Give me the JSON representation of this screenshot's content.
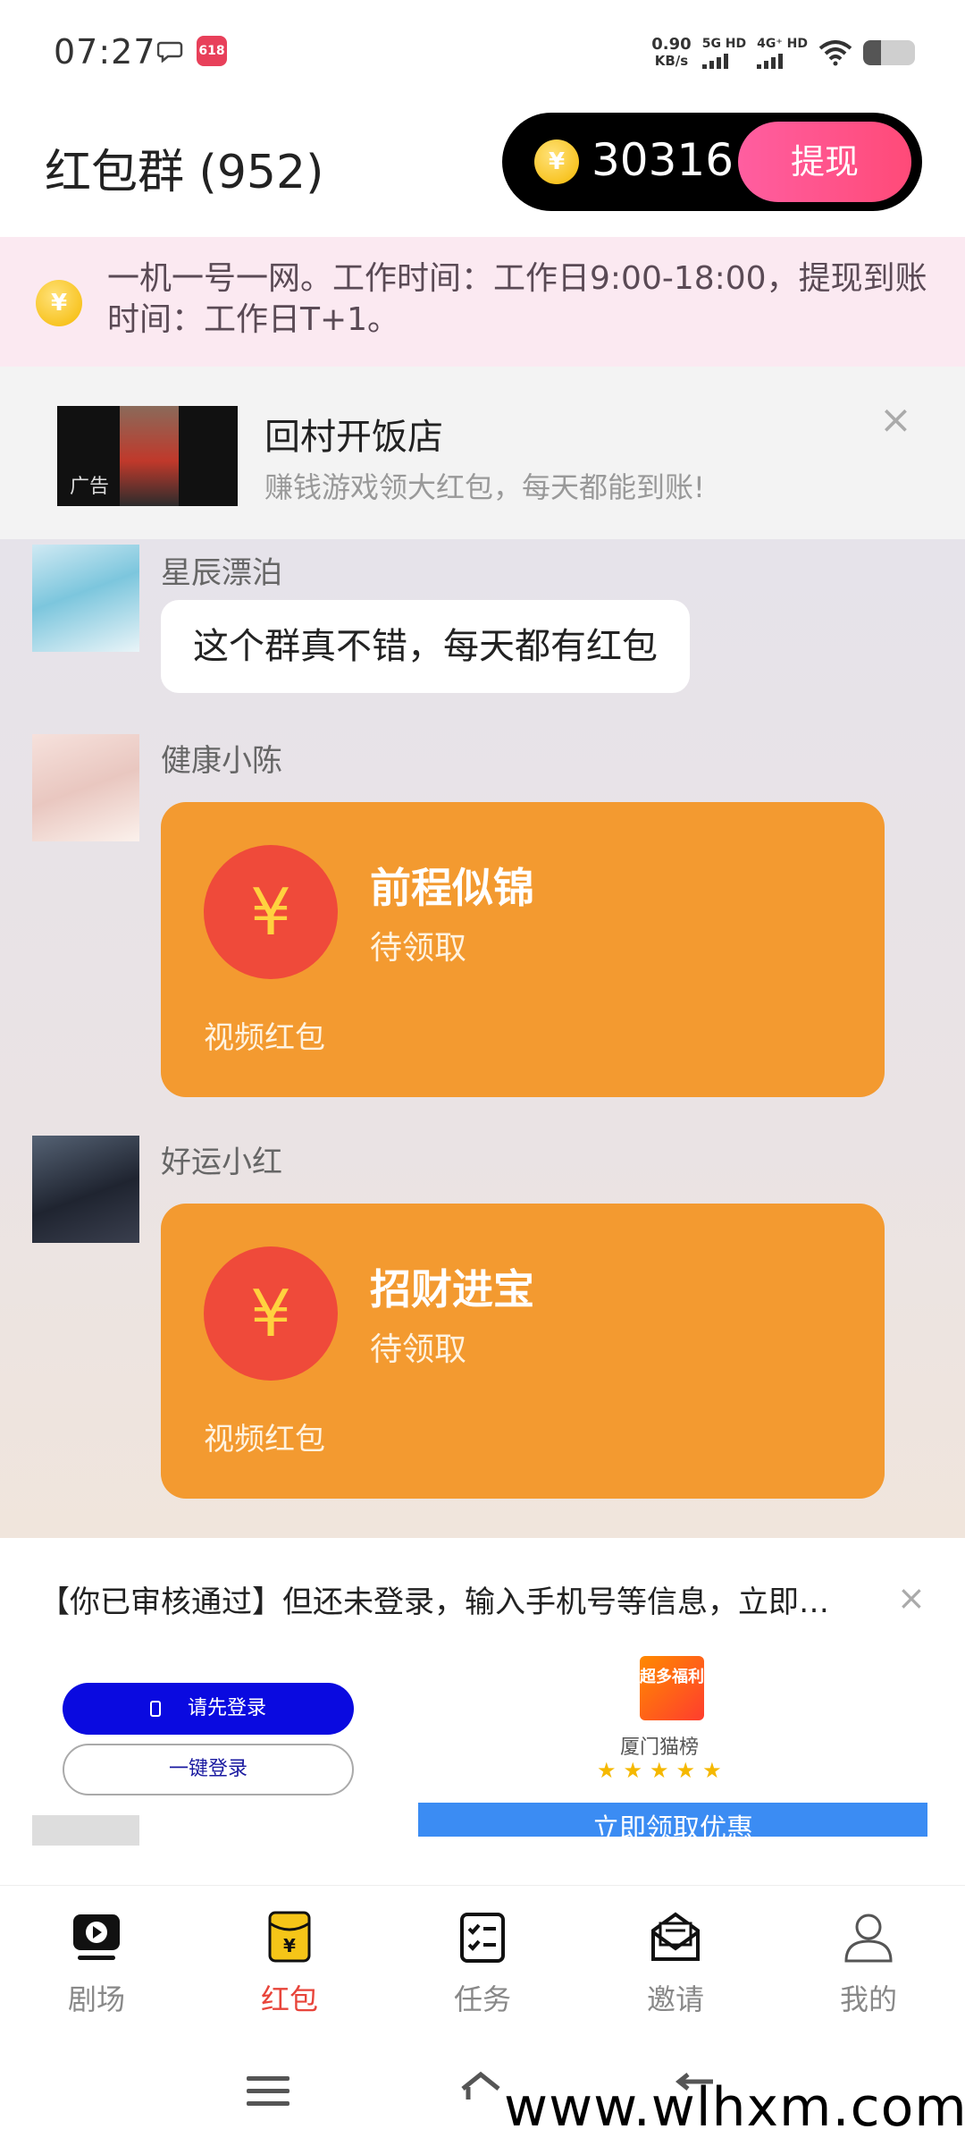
{
  "status_bar": {
    "time": "07:27",
    "speed_value": "0.90",
    "speed_unit": "KB/s",
    "net1": "5G HD",
    "net2": "4G⁺ HD",
    "battery_level": 0.35,
    "app_badge": "618"
  },
  "header": {
    "title": "红包群 (952)",
    "balance": "30316",
    "withdraw_label": "提现",
    "coin_symbol": "¥"
  },
  "notice": {
    "icon_symbol": "¥",
    "text": "一机一号一网。工作时间：工作日9:00-18:00，提现到账时间：工作日T+1。"
  },
  "ad_banner": {
    "tag": "广告",
    "title": "回村开饭店",
    "subtitle": "赚钱游戏领大红包，每天都能到账!",
    "close": "×"
  },
  "messages": [
    {
      "sender": "星辰漂泊",
      "type": "text",
      "text": "这个群真不错，每天都有红包"
    },
    {
      "sender": "健康小陈",
      "type": "redpacket",
      "title": "前程似锦",
      "status": "待领取",
      "packet_type": "视频红包",
      "symbol": "¥"
    },
    {
      "sender": "好运小红",
      "type": "redpacket",
      "title": "招财进宝",
      "status": "待领取",
      "packet_type": "视频红包",
      "symbol": "¥"
    }
  ],
  "bottom_ad": {
    "text": "【你已审核通过】但还未登录，输入手机号等信息，立即…",
    "close": "×",
    "login_label": "请先登录",
    "quick_login_label": "一键登录",
    "promo_logo": "超多福利",
    "promo_name": "厦门猫榜",
    "stars": "★★★★★",
    "promo_button": "立即领取优惠"
  },
  "nav": {
    "items": [
      {
        "label": "剧场"
      },
      {
        "label": "红包"
      },
      {
        "label": "任务"
      },
      {
        "label": "邀请"
      },
      {
        "label": "我的"
      }
    ],
    "active_color": "#e8443a"
  },
  "watermark": "www.wlhxm.com"
}
